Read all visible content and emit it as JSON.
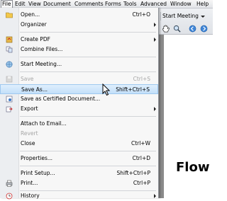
{
  "menubar": {
    "items": [
      "File",
      "Edit",
      "View",
      "Document",
      "Comments",
      "Forms",
      "Tools",
      "Advanced",
      "Window",
      "Help"
    ]
  },
  "toolbar": {
    "start_meeting_label": "Start Meeting",
    "icons": [
      "hand-icon",
      "zoom-icon",
      "back-icon",
      "forward-icon"
    ]
  },
  "document": {
    "visible_text": "Flow"
  },
  "file_menu": {
    "items": [
      {
        "label": "Open...",
        "shortcut": "Ctrl+O",
        "icon": "open-folder-icon",
        "disabled": false
      },
      {
        "label": "Organizer",
        "shortcut": "",
        "submenu": true,
        "disabled": false
      },
      {
        "label": "Create PDF",
        "shortcut": "",
        "submenu": true,
        "icon": "create-pdf-icon",
        "disabled": false
      },
      {
        "label": "Combine Files...",
        "shortcut": "",
        "icon": "combine-files-icon",
        "disabled": false
      },
      {
        "label": "Start Meeting...",
        "shortcut": "",
        "icon": "meeting-icon",
        "disabled": false
      },
      {
        "label": "Save",
        "shortcut": "Ctrl+S",
        "icon": "save-icon",
        "disabled": true
      },
      {
        "label": "Save As...",
        "shortcut": "Shift+Ctrl+S",
        "disabled": false,
        "highlighted": true
      },
      {
        "label": "Save as Certified Document...",
        "shortcut": "",
        "icon": "certified-icon",
        "disabled": false
      },
      {
        "label": "Export",
        "shortcut": "",
        "submenu": true,
        "icon": "export-icon",
        "disabled": false
      },
      {
        "label": "Attach to Email...",
        "shortcut": "",
        "disabled": false
      },
      {
        "label": "Revert",
        "shortcut": "",
        "disabled": true
      },
      {
        "label": "Close",
        "shortcut": "Ctrl+W",
        "disabled": false
      },
      {
        "label": "Properties...",
        "shortcut": "Ctrl+D",
        "disabled": false
      },
      {
        "label": "Print Setup...",
        "shortcut": "Shift+Ctrl+P",
        "disabled": false
      },
      {
        "label": "Print...",
        "shortcut": "Ctrl+P",
        "icon": "print-icon",
        "disabled": false
      },
      {
        "label": "History",
        "shortcut": "",
        "submenu": true,
        "icon": "history-icon",
        "disabled": false
      }
    ]
  },
  "colors": {
    "highlight": "#c3dff9",
    "disabled_text": "#a5a5a5",
    "menu_bg": "#f7f7f7"
  }
}
